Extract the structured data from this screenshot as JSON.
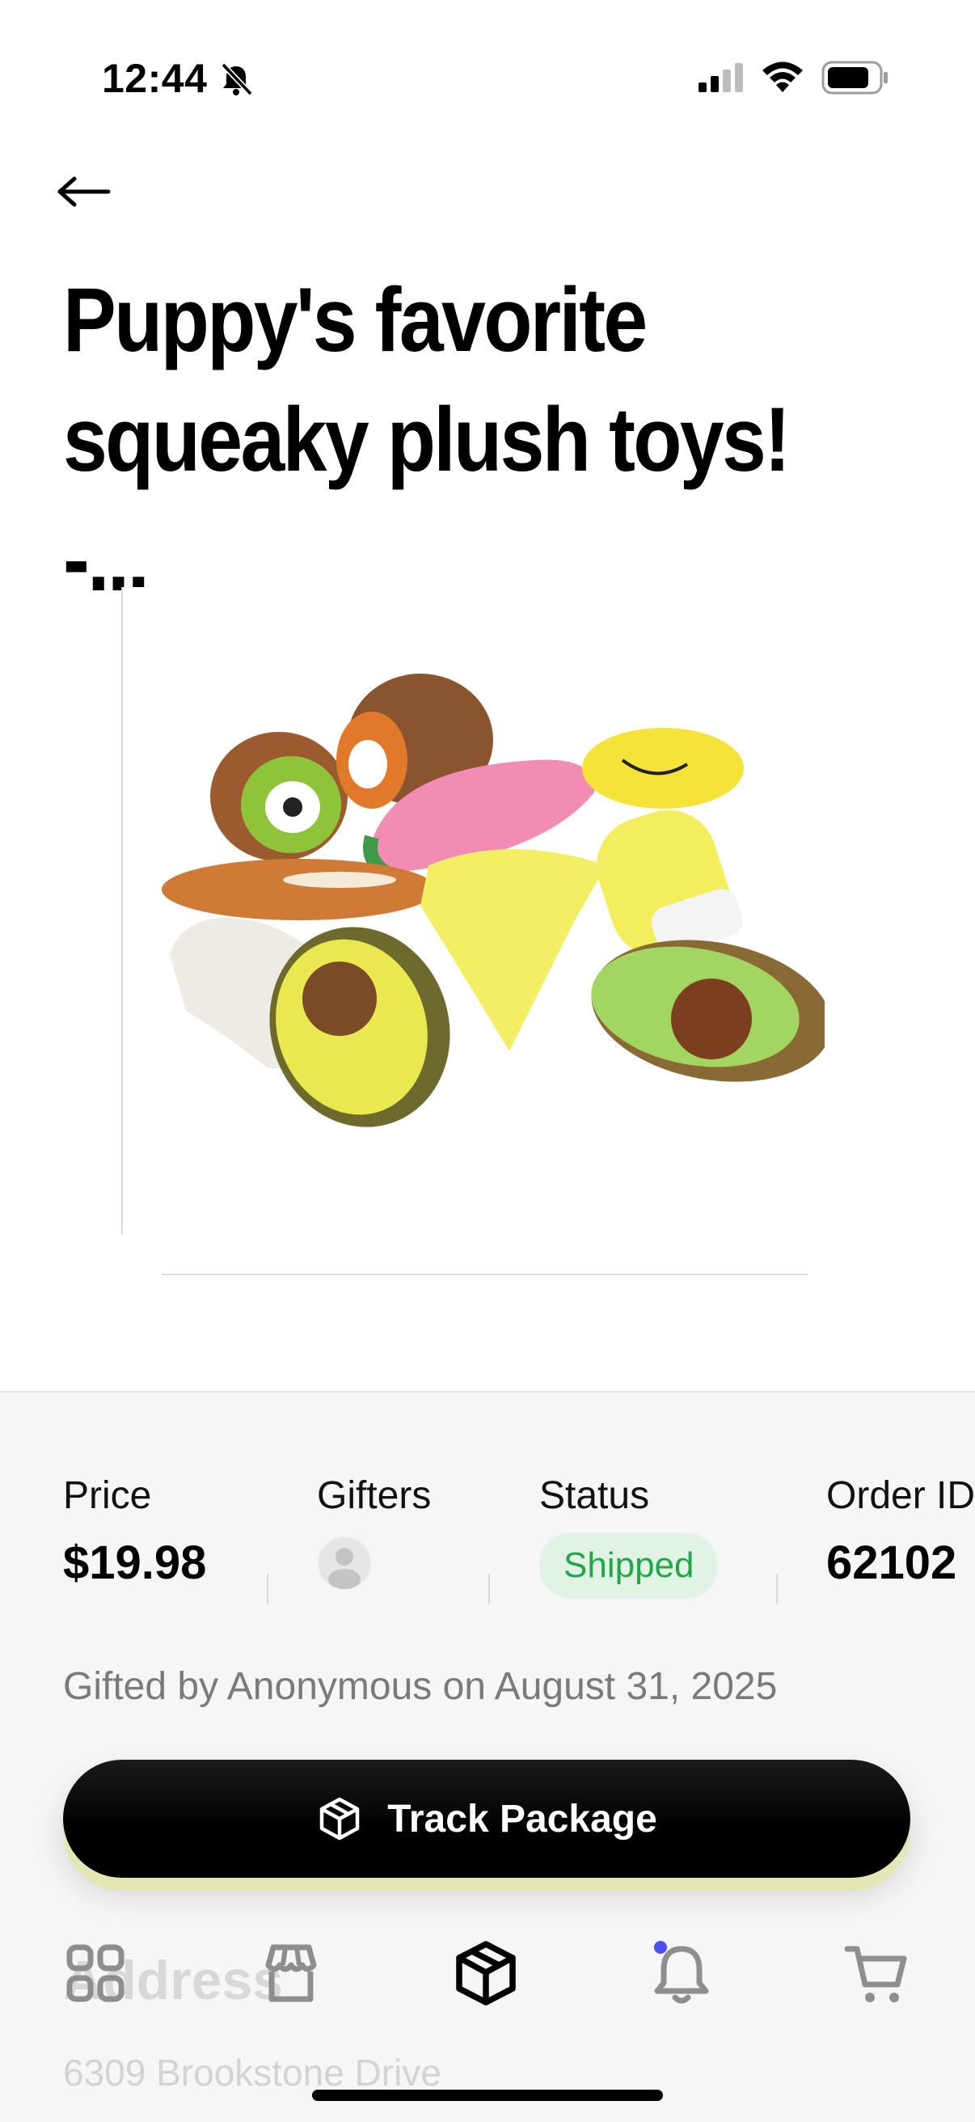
{
  "status_bar": {
    "time": "12:44"
  },
  "header": {
    "title": "Puppy's favorite\nsqueaky plush toys! -..."
  },
  "details": {
    "price_label": "Price",
    "price_value": "$19.98",
    "gifters_label": "Gifters",
    "status_label": "Status",
    "status_value": "Shipped",
    "order_label": "Order ID",
    "order_value": "62102"
  },
  "gifted_text": "Gifted by Anonymous on August 31, 2025",
  "track_button_label": "Track Package",
  "address": {
    "heading": "Address",
    "street": "6309 Brookstone Drive"
  },
  "colors": {
    "status_green": "#22a64a",
    "status_bg": "#e1f3e5",
    "notification_dot": "#4b4ff0"
  },
  "nav": [
    {
      "icon": "grid-icon"
    },
    {
      "icon": "store-icon"
    },
    {
      "icon": "package-icon",
      "active": true
    },
    {
      "icon": "bell-icon"
    },
    {
      "icon": "cart-icon"
    }
  ]
}
